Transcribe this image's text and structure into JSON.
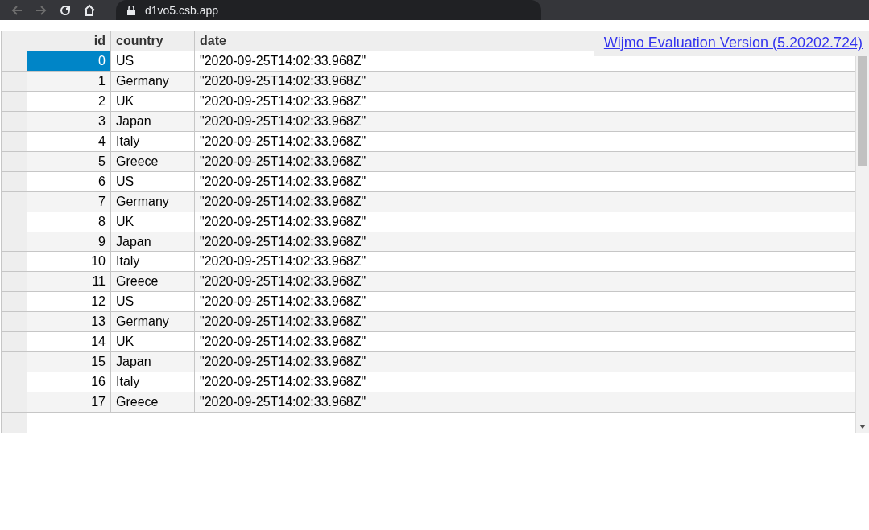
{
  "browser": {
    "url": "d1vo5.csb.app"
  },
  "grid": {
    "columns": [
      "id",
      "country",
      "date"
    ],
    "rows": [
      {
        "id": "0",
        "country": "US",
        "date": "\"2020-09-25T14:02:33.968Z\"",
        "selected": true
      },
      {
        "id": "1",
        "country": "Germany",
        "date": "\"2020-09-25T14:02:33.968Z\"",
        "selected": false
      },
      {
        "id": "2",
        "country": "UK",
        "date": "\"2020-09-25T14:02:33.968Z\"",
        "selected": false
      },
      {
        "id": "3",
        "country": "Japan",
        "date": "\"2020-09-25T14:02:33.968Z\"",
        "selected": false
      },
      {
        "id": "4",
        "country": "Italy",
        "date": "\"2020-09-25T14:02:33.968Z\"",
        "selected": false
      },
      {
        "id": "5",
        "country": "Greece",
        "date": "\"2020-09-25T14:02:33.968Z\"",
        "selected": false
      },
      {
        "id": "6",
        "country": "US",
        "date": "\"2020-09-25T14:02:33.968Z\"",
        "selected": false
      },
      {
        "id": "7",
        "country": "Germany",
        "date": "\"2020-09-25T14:02:33.968Z\"",
        "selected": false
      },
      {
        "id": "8",
        "country": "UK",
        "date": "\"2020-09-25T14:02:33.968Z\"",
        "selected": false
      },
      {
        "id": "9",
        "country": "Japan",
        "date": "\"2020-09-25T14:02:33.968Z\"",
        "selected": false
      },
      {
        "id": "10",
        "country": "Italy",
        "date": "\"2020-09-25T14:02:33.968Z\"",
        "selected": false
      },
      {
        "id": "11",
        "country": "Greece",
        "date": "\"2020-09-25T14:02:33.968Z\"",
        "selected": false
      },
      {
        "id": "12",
        "country": "US",
        "date": "\"2020-09-25T14:02:33.968Z\"",
        "selected": false
      },
      {
        "id": "13",
        "country": "Germany",
        "date": "\"2020-09-25T14:02:33.968Z\"",
        "selected": false
      },
      {
        "id": "14",
        "country": "UK",
        "date": "\"2020-09-25T14:02:33.968Z\"",
        "selected": false
      },
      {
        "id": "15",
        "country": "Japan",
        "date": "\"2020-09-25T14:02:33.968Z\"",
        "selected": false
      },
      {
        "id": "16",
        "country": "Italy",
        "date": "\"2020-09-25T14:02:33.968Z\"",
        "selected": false
      },
      {
        "id": "17",
        "country": "Greece",
        "date": "\"2020-09-25T14:02:33.968Z\"",
        "selected": false
      }
    ]
  },
  "watermark_link": "Wijmo Evaluation Version (5.20202.724)"
}
